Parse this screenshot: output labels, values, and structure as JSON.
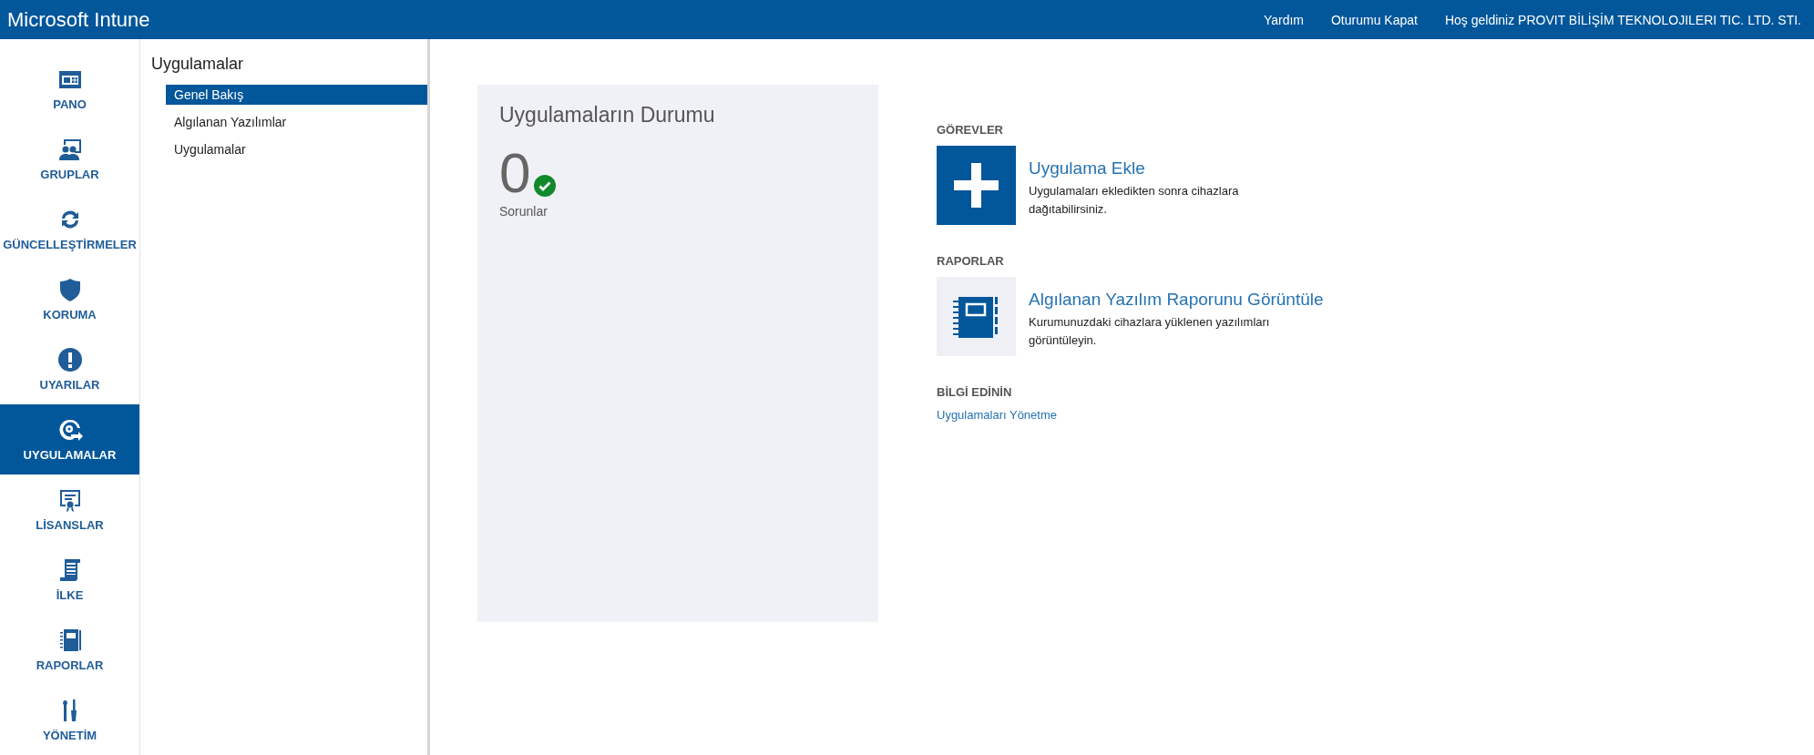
{
  "header": {
    "title": "Microsoft Intune",
    "links": [
      "Yardım",
      "Oturumu Kapat"
    ],
    "welcome": "Hoş geldiniz PROVIT BİLİŞİM TEKNOLOJILERI TIC. LTD. STI."
  },
  "nav": [
    {
      "label": "PANO",
      "selected": false
    },
    {
      "label": "GRUPLAR",
      "selected": false
    },
    {
      "label": "GÜNCELLEŞTİRMELER",
      "selected": false
    },
    {
      "label": "KORUMA",
      "selected": false
    },
    {
      "label": "UYARILAR",
      "selected": false
    },
    {
      "label": "UYGULAMALAR",
      "selected": true
    },
    {
      "label": "LİSANSLAR",
      "selected": false
    },
    {
      "label": "İLKE",
      "selected": false
    },
    {
      "label": "RAPORLAR",
      "selected": false
    },
    {
      "label": "YÖNETİM",
      "selected": false
    }
  ],
  "subnav": {
    "title": "Uygulamalar",
    "items": [
      {
        "label": "Genel Bakış",
        "selected": true
      },
      {
        "label": "Algılanan Yazılımlar",
        "selected": false
      },
      {
        "label": "Uygulamalar",
        "selected": false
      }
    ]
  },
  "status_card": {
    "title": "Uygulamaların Durumu",
    "count": "0",
    "ok": true,
    "caption": "Sorunlar"
  },
  "sections": [
    {
      "heading": "GÖREVLER",
      "items": [
        {
          "kind": "add",
          "title": "Uygulama Ekle",
          "description": "Uygulamaları ekledikten sonra cihazlara dağıtabilirsiniz."
        }
      ]
    },
    {
      "heading": "RAPORLAR",
      "items": [
        {
          "kind": "report",
          "title": "Algılanan Yazılım Raporunu Görüntüle",
          "description": "Kurumunuzdaki cihazlara yüklenen yazılımları görüntüleyin."
        }
      ]
    }
  ],
  "learn": {
    "heading": "BİLGİ EDİNİN",
    "link": "Uygulamaları Yönetme"
  }
}
